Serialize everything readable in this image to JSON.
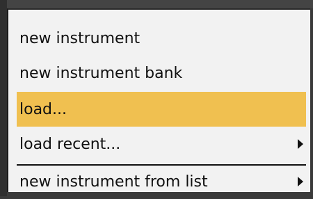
{
  "menu": {
    "items": [
      {
        "label": "new instrument",
        "highlighted": false,
        "has_submenu": false
      },
      {
        "label": "new instrument bank",
        "highlighted": false,
        "has_submenu": false
      },
      {
        "label": "load...",
        "highlighted": true,
        "has_submenu": false
      },
      {
        "label": "load recent...",
        "highlighted": false,
        "has_submenu": true
      },
      {
        "label": "new instrument from list",
        "highlighted": false,
        "has_submenu": true
      }
    ],
    "highlight_color": "#f0c050",
    "background_color": "#f2f2f2",
    "submenu_icon": "triangle-right-icon"
  }
}
